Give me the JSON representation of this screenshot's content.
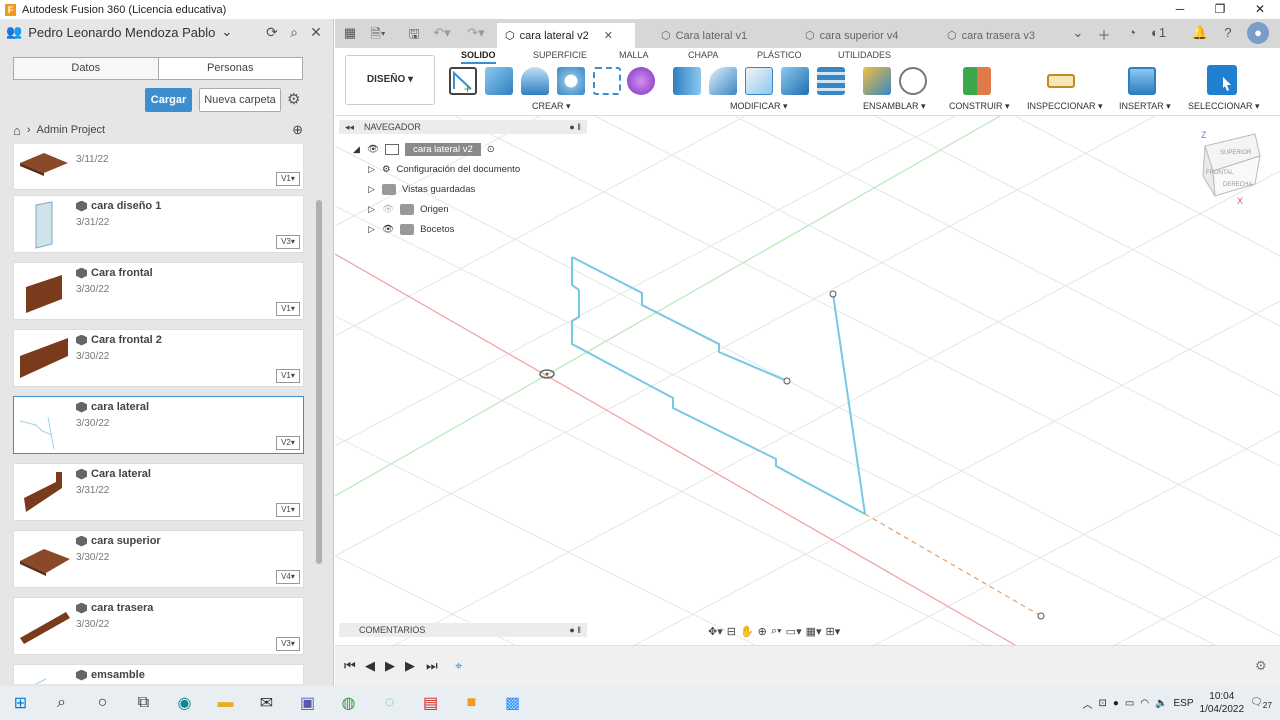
{
  "window": {
    "title": "Autodesk Fusion 360 (Licencia educativa)",
    "logo": "F"
  },
  "left_panel": {
    "user": "Pedro Leonardo Mendoza Pablo",
    "tabs": [
      "Datos",
      "Personas"
    ],
    "upload_label": "Cargar",
    "new_folder_label": "Nueva carpeta",
    "breadcrumb": "Admin Project",
    "files": [
      {
        "name": "",
        "date": "3/11/22",
        "version": "V1▾"
      },
      {
        "name": "cara diseño 1",
        "date": "3/31/22",
        "version": "V3▾"
      },
      {
        "name": "Cara frontal",
        "date": "3/30/22",
        "version": "V1▾"
      },
      {
        "name": "Cara frontal 2",
        "date": "3/30/22",
        "version": "V1▾"
      },
      {
        "name": "cara lateral",
        "date": "3/30/22",
        "version": "V2▾"
      },
      {
        "name": "Cara lateral",
        "date": "3/31/22",
        "version": "V1▾"
      },
      {
        "name": "cara superior",
        "date": "3/30/22",
        "version": "V4▾"
      },
      {
        "name": "cara trasera",
        "date": "3/30/22",
        "version": "V3▾"
      },
      {
        "name": "emsamble",
        "date": "",
        "version": ""
      }
    ]
  },
  "doc_tabs": [
    {
      "label": "cara lateral v2",
      "active": true
    },
    {
      "label": "Cara lateral v1",
      "active": false
    },
    {
      "label": "cara superior v4",
      "active": false
    },
    {
      "label": "cara trasera v3",
      "active": false
    }
  ],
  "notifications_count": "1",
  "toolbar": {
    "design_label": "DISEÑO ▾",
    "tabs": [
      "SOLIDO",
      "SUPERFICIE",
      "MALLA",
      "CHAPA",
      "PLÁSTICO",
      "UTILIDADES"
    ],
    "groups": [
      "CREAR ▾",
      "MODIFICAR ▾",
      "ENSAMBLAR ▾",
      "CONSTRUIR ▾",
      "INSPECCIONAR ▾",
      "INSERTAR ▾",
      "SELECCIONAR ▾"
    ]
  },
  "navigator": {
    "title": "NAVEGADOR",
    "root": "cara lateral v2",
    "items": [
      "Configuración del documento",
      "Vistas guardadas",
      "Origen",
      "Bocetos"
    ]
  },
  "comments_label": "COMENTARIOS",
  "viewcube": {
    "front": "FRONTAL",
    "right": "DERECHA",
    "top": "SUPERIOR",
    "axis_z": "Z",
    "axis_x": "X"
  },
  "taskbar": {
    "lang": "ESP",
    "time": "10:04",
    "date": "1/04/2022",
    "notif": "27"
  },
  "colors": {
    "accent": "#3d8ecf",
    "sketch": "#78c8e4",
    "axis_red": "#f08080",
    "axis_green": "#9ee59e",
    "axis_orange": "#e8a060"
  }
}
